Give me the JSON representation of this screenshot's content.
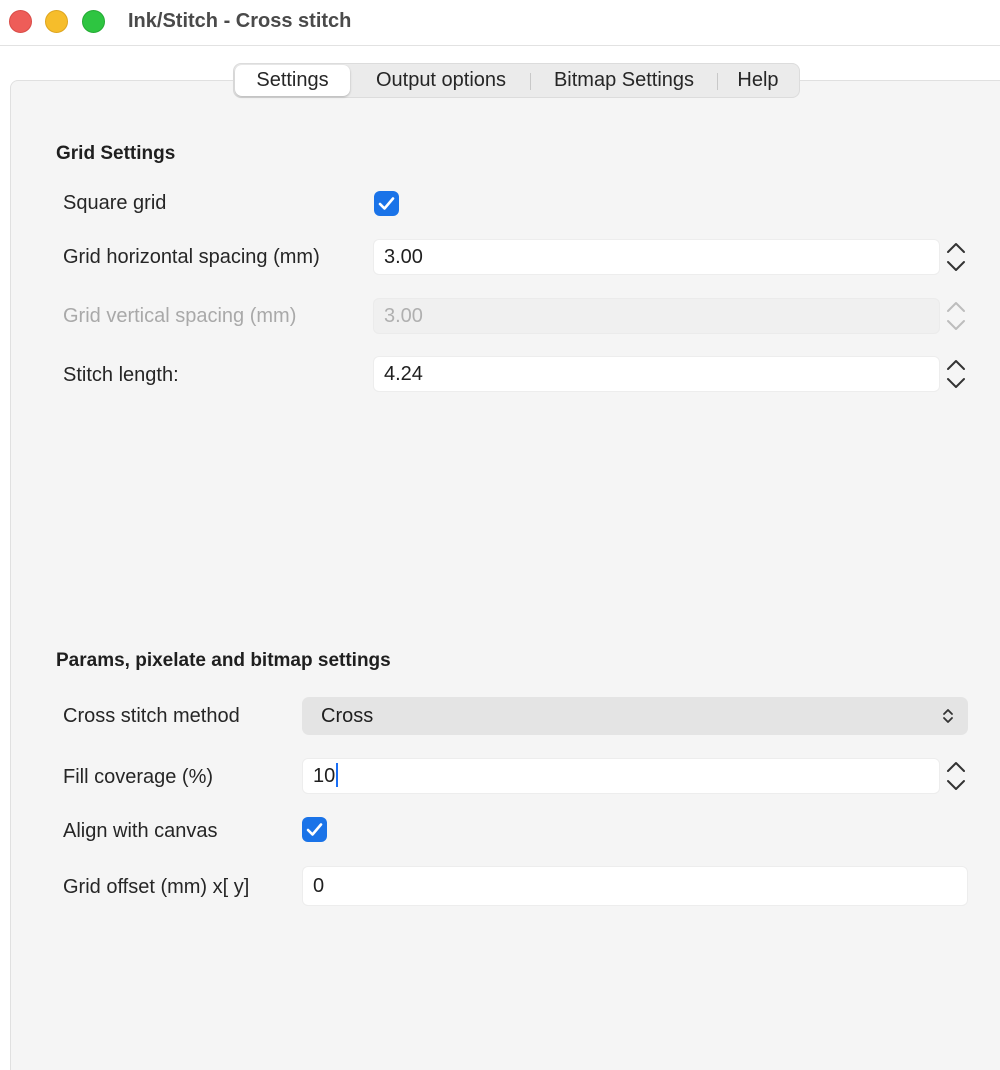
{
  "window": {
    "title": "Ink/Stitch - Cross stitch"
  },
  "tabs": [
    {
      "label": "Settings",
      "active": true
    },
    {
      "label": "Output options",
      "active": false
    },
    {
      "label": "Bitmap Settings",
      "active": false
    },
    {
      "label": "Help",
      "active": false
    }
  ],
  "grid_settings": {
    "title": "Grid Settings",
    "square_grid": {
      "label": "Square grid",
      "checked": true
    },
    "horizontal_spacing": {
      "label": "Grid horizontal spacing (mm)",
      "value": "3.00"
    },
    "vertical_spacing": {
      "label": "Grid vertical spacing (mm)",
      "value": "3.00",
      "disabled": true
    },
    "stitch_length": {
      "label": "Stitch length:",
      "value": "4.24"
    }
  },
  "params": {
    "title": "Params, pixelate and bitmap settings",
    "method": {
      "label": "Cross stitch method",
      "value": "Cross"
    },
    "fill_coverage": {
      "label": "Fill coverage (%)",
      "value": "10"
    },
    "align_canvas": {
      "label": "Align with canvas",
      "checked": true
    },
    "grid_offset": {
      "label": "Grid offset (mm) x[ y]",
      "value": "0"
    }
  },
  "colors": {
    "accent": "#1a73e8",
    "close": "#ee5d58",
    "minimize": "#f6bd2b",
    "maximize": "#2ec541"
  }
}
